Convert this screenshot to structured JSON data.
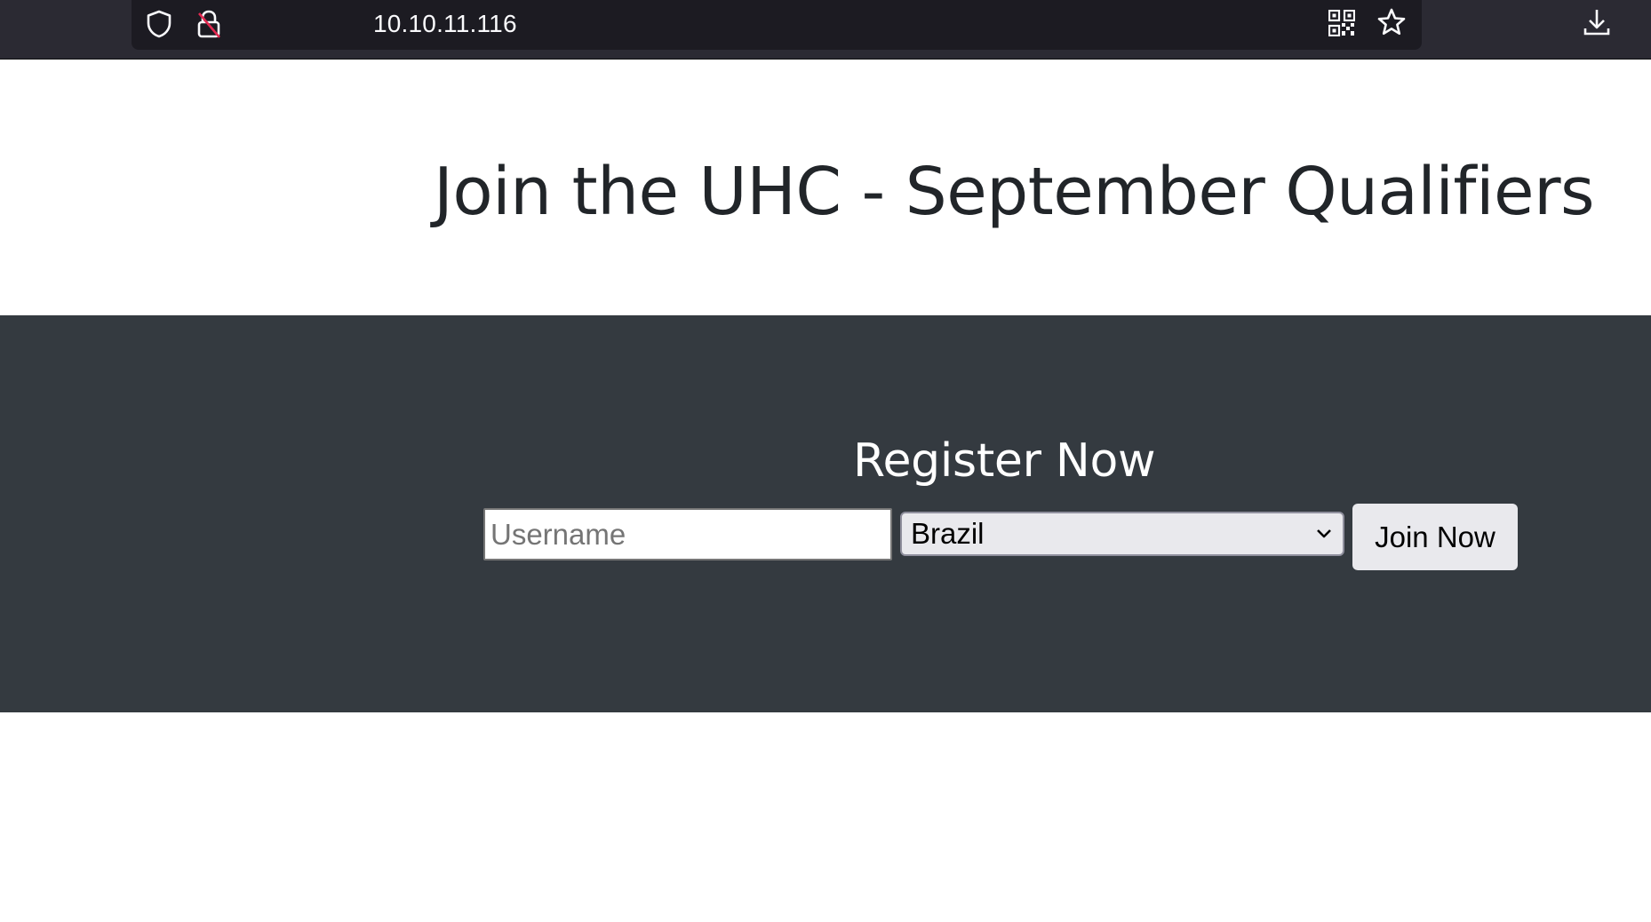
{
  "browser": {
    "url": "10.10.11.116",
    "icons": {
      "tracking_protection": "shield-icon",
      "insecure_connection": "lock-slash-icon",
      "qr_code": "qr-code-icon",
      "bookmark": "star-icon",
      "downloads": "download-icon"
    }
  },
  "page": {
    "title": "Join the UHC - September Qualifiers",
    "band_color": "#343a40"
  },
  "register": {
    "heading": "Register Now",
    "username_placeholder": "Username",
    "username_value": "",
    "country_selected": "Brazil",
    "join_label": "Join Now"
  }
}
